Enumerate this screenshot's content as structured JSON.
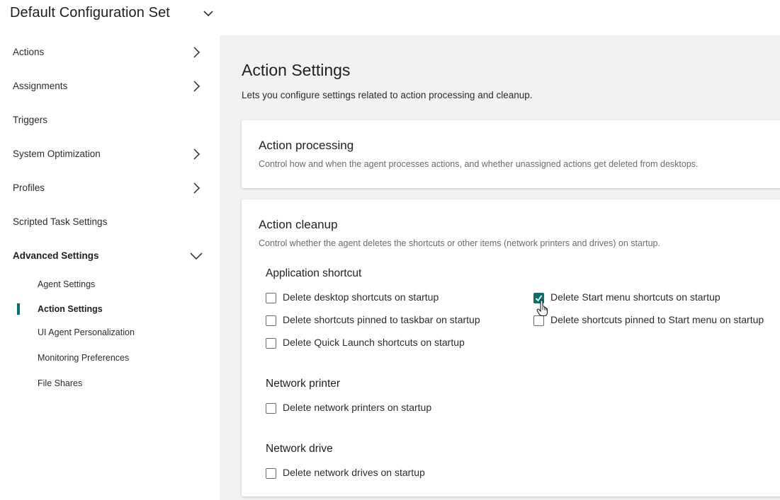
{
  "header": {
    "title": "Default Configuration Set",
    "toggle_icon": "chevron-down-icon"
  },
  "sidebar": {
    "items": [
      {
        "label": "Actions",
        "has_children": true,
        "expanded": false
      },
      {
        "label": "Assignments",
        "has_children": true,
        "expanded": false
      },
      {
        "label": "Triggers",
        "has_children": false
      },
      {
        "label": "System Optimization",
        "has_children": true,
        "expanded": false
      },
      {
        "label": "Profiles",
        "has_children": true,
        "expanded": false
      },
      {
        "label": "Scripted Task Settings",
        "has_children": false
      },
      {
        "label": "Advanced Settings",
        "has_children": true,
        "expanded": true
      }
    ],
    "sub_items": [
      {
        "label": "Agent Settings",
        "active": false
      },
      {
        "label": "Action Settings",
        "active": true
      },
      {
        "label": "UI Agent Personalization",
        "active": false
      },
      {
        "label": "Monitoring Preferences",
        "active": false
      },
      {
        "label": "File Shares",
        "active": false
      }
    ],
    "active_color": "#0b6e6e"
  },
  "main": {
    "title": "Action Settings",
    "description": "Lets you configure settings related to action processing and cleanup.",
    "processing": {
      "title": "Action processing",
      "description": "Control how and when the agent processes actions, and whether unassigned actions get deleted from desktops."
    },
    "cleanup": {
      "title": "Action cleanup",
      "description": "Control whether the agent deletes the shortcuts or other items (network printers and drives) on startup.",
      "app_shortcut": {
        "title": "Application shortcut",
        "options": [
          {
            "label": "Delete desktop shortcuts on startup",
            "checked": false
          },
          {
            "label": "Delete Start menu shortcuts on startup",
            "checked": true
          },
          {
            "label": "Delete shortcuts pinned to taskbar on startup",
            "checked": false
          },
          {
            "label": "Delete shortcuts pinned to Start menu on startup",
            "checked": false
          },
          {
            "label": "Delete Quick Launch shortcuts on startup",
            "checked": false
          }
        ]
      },
      "network_printer": {
        "title": "Network printer",
        "options": [
          {
            "label": "Delete network printers on startup",
            "checked": false
          }
        ]
      },
      "network_drive": {
        "title": "Network drive",
        "options": [
          {
            "label": "Delete network drives on startup",
            "checked": false
          }
        ]
      }
    }
  },
  "colors": {
    "accent": "#0b6e6e",
    "main_background": "#f2f2f2"
  }
}
